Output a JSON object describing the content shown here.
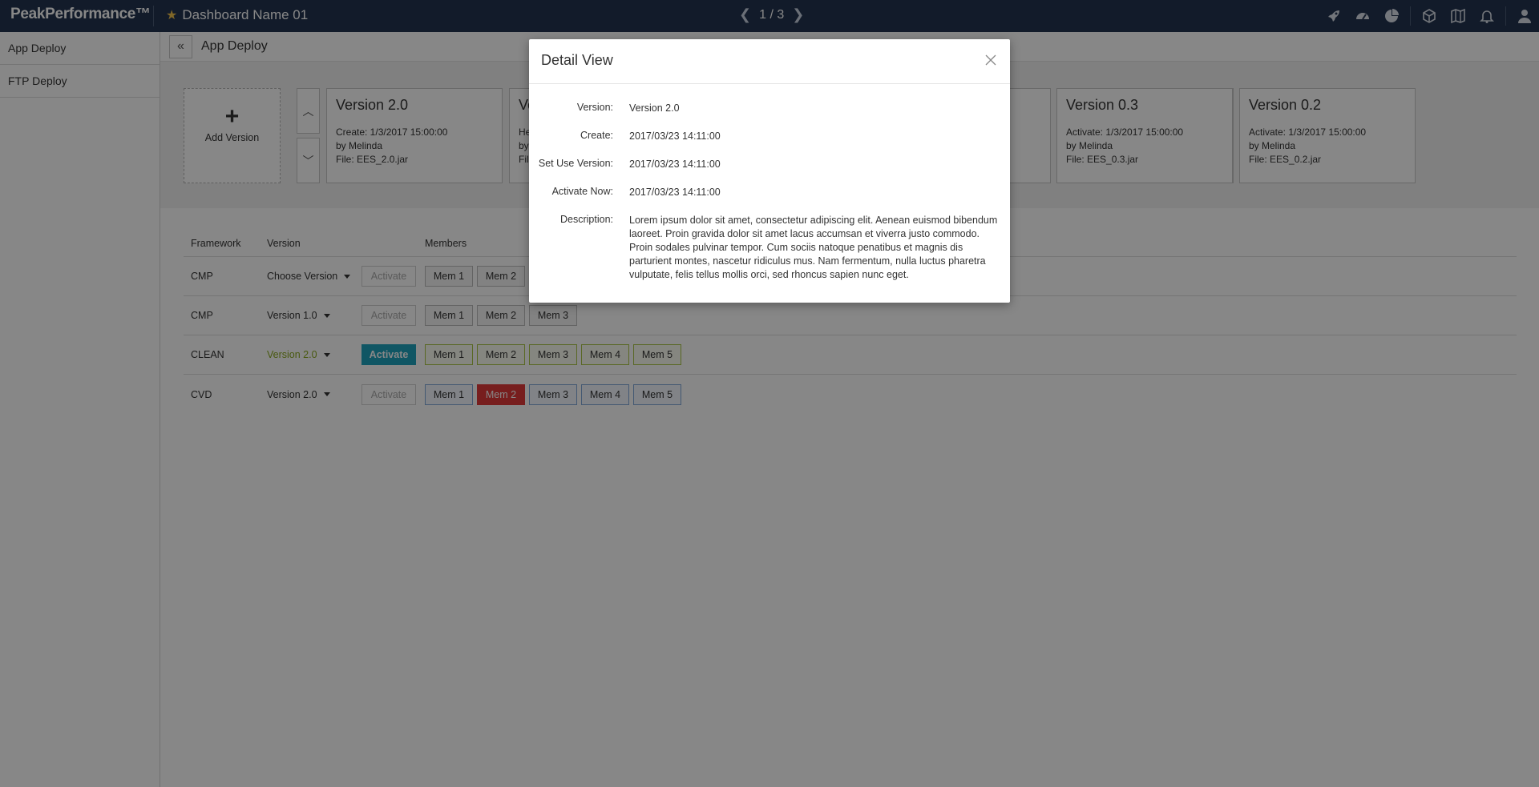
{
  "topbar": {
    "brand": "PeakPerformance™",
    "dashboard_title": "Dashboard Name 01",
    "pager": "1 / 3",
    "icons": [
      "rocket-icon",
      "dashboard-gauge-icon",
      "pie-chart-icon",
      "cube-icon",
      "map-icon",
      "bell-icon",
      "user-icon"
    ]
  },
  "sidebar": {
    "items": [
      {
        "label": "App Deploy"
      },
      {
        "label": "FTP Deploy"
      }
    ]
  },
  "main": {
    "page_title": "App Deploy",
    "add_version_label": "Add Version",
    "versions": [
      {
        "title": "Version 2.0",
        "line1": "Create: 1/3/2017 15:00:00",
        "line2": "by Melinda",
        "line3": "File: EES_2.0.jar"
      },
      {
        "title": "Ve",
        "line1": "He",
        "line2": "by",
        "line3": "Fil"
      },
      {
        "title": "Version 0.3",
        "line1": "Activate: 1/3/2017 15:00:00",
        "line2": "by Melinda",
        "line3": "File: EES_0.3.jar"
      },
      {
        "title": "Version 0.2",
        "line1": "Activate: 1/3/2017 15:00:00",
        "line2": "by Melinda",
        "line3": "File: EES_0.2.jar"
      }
    ],
    "table": {
      "headers": {
        "framework": "Framework",
        "version": "Version",
        "members": "Members"
      },
      "rows": [
        {
          "framework": "CMP",
          "version": "Choose Version",
          "activate": "Activate",
          "members": [
            "Mem 1",
            "Mem 2"
          ]
        },
        {
          "framework": "CMP",
          "version": "Version 1.0",
          "activate": "Activate",
          "members": [
            "Mem 1",
            "Mem 2",
            "Mem 3"
          ]
        },
        {
          "framework": "CLEAN",
          "version": "Version 2.0",
          "activate": "Activate",
          "members": [
            "Mem 1",
            "Mem 2",
            "Mem 3",
            "Mem 4",
            "Mem 5"
          ]
        },
        {
          "framework": "CVD",
          "version": "Version 2.0",
          "activate": "Activate",
          "members": [
            "Mem 1",
            "Mem 2",
            "Mem 3",
            "Mem 4",
            "Mem 5"
          ]
        }
      ]
    }
  },
  "modal": {
    "title": "Detail View",
    "fields": [
      {
        "label": "Version:",
        "value": "Version 2.0"
      },
      {
        "label": "Create:",
        "value": "2017/03/23 14:11:00"
      },
      {
        "label": "Set Use Version:",
        "value": "2017/03/23 14:11:00"
      },
      {
        "label": "Activate Now:",
        "value": "2017/03/23 14:11:00"
      },
      {
        "label": "Description:",
        "value": "Lorem ipsum dolor sit amet, consectetur adipiscing elit. Aenean euismod bibendum laoreet. Proin gravida dolor sit amet lacus accumsan et viverra justo commodo. Proin sodales pulvinar tempor. Cum sociis natoque penatibus et magnis dis parturient montes, nascetur ridiculus mus. Nam fermentum, nulla luctus pharetra vulputate, felis tellus mollis orci, sed rhoncus sapien nunc eget."
      }
    ]
  },
  "colors": {
    "topbar_bg": "#233450",
    "activate_active": "#1fa2be",
    "version_highlight": "#8aa81f",
    "member_alert": "#e03a3a",
    "star": "#f2c24d"
  }
}
